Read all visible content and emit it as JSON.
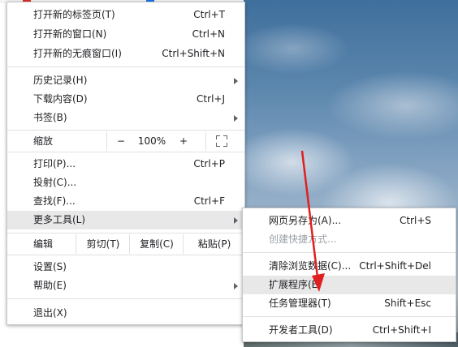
{
  "colors": {
    "menu_bg": "#ffffff",
    "highlight": "#e8e8e9",
    "disabled_text": "#9aa0a6",
    "annotation_arrow": "#e02020"
  },
  "main_menu": {
    "new_tab": {
      "label": "打开新的标签页(T)",
      "accel": "Ctrl+T"
    },
    "new_window": {
      "label": "打开新的窗口(N)",
      "accel": "Ctrl+N"
    },
    "new_incognito": {
      "label": "打开新的无痕窗口(I)",
      "accel": "Ctrl+Shift+N"
    },
    "history": {
      "label": "历史记录(H)"
    },
    "downloads": {
      "label": "下载内容(D)",
      "accel": "Ctrl+J"
    },
    "bookmarks": {
      "label": "书签(B)"
    },
    "zoom": {
      "label": "缩放",
      "minus": "−",
      "value": "100%",
      "plus": "+",
      "fullscreen_icon": "fullscreen-icon"
    },
    "print": {
      "label": "打印(P)...",
      "accel": "Ctrl+P"
    },
    "cast": {
      "label": "投射(C)..."
    },
    "find": {
      "label": "查找(F)...",
      "accel": "Ctrl+F"
    },
    "more_tools": {
      "label": "更多工具(L)"
    },
    "edit": {
      "label": "编辑",
      "cut": "剪切(T)",
      "copy": "复制(C)",
      "paste": "粘贴(P)"
    },
    "settings": {
      "label": "设置(S)"
    },
    "help": {
      "label": "帮助(E)"
    },
    "exit": {
      "label": "退出(X)"
    }
  },
  "sub_menu": {
    "save_page": {
      "label": "网页另存为(A)...",
      "accel": "Ctrl+S"
    },
    "create_shortcut": {
      "label": "创建快捷方式..."
    },
    "clear_data": {
      "label": "清除浏览数据(C)...",
      "accel": "Ctrl+Shift+Del"
    },
    "extensions": {
      "label": "扩展程序(E)"
    },
    "task_manager": {
      "label": "任务管理器(T)",
      "accel": "Shift+Esc"
    },
    "devtools": {
      "label": "开发者工具(D)",
      "accel": "Ctrl+Shift+I"
    }
  }
}
